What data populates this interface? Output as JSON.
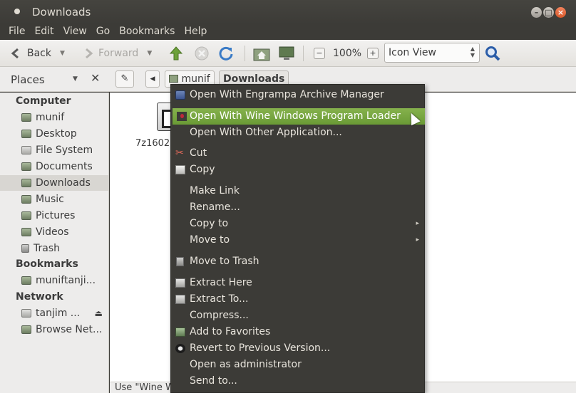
{
  "window": {
    "title": "Downloads"
  },
  "menubar": [
    "File",
    "Edit",
    "View",
    "Go",
    "Bookmarks",
    "Help"
  ],
  "toolbar": {
    "back_label": "Back",
    "forward_label": "Forward",
    "zoom_level": "100%",
    "view_mode": "Icon View"
  },
  "pathbar": {
    "places_label": "Places",
    "crumbs": [
      "munif",
      "Downloads"
    ]
  },
  "sidebar": {
    "computer_header": "Computer",
    "computer_items": [
      "munif",
      "Desktop",
      "File System",
      "Documents",
      "Downloads",
      "Music",
      "Pictures",
      "Videos",
      "Trash"
    ],
    "bookmarks_header": "Bookmarks",
    "bookmarks_items": [
      "muniftanji..."
    ],
    "network_header": "Network",
    "network_items": [
      "tanjim ...",
      "Browse Net..."
    ]
  },
  "content": {
    "file_label": "7z1602",
    "status_text": "Use \"Wine W"
  },
  "context_menu": {
    "items": [
      "Open With Engrampa Archive Manager",
      "Open With Wine Windows Program Loader",
      "Open With Other Application...",
      "Cut",
      "Copy",
      "Make Link",
      "Rename...",
      "Copy to",
      "Move to",
      "Move to Trash",
      "Extract Here",
      "Extract To...",
      "Compress...",
      "Add to Favorites",
      "Revert to Previous Version...",
      "Open as administrator",
      "Send to..."
    ],
    "highlighted_index": 1
  },
  "colors": {
    "titlebar": "#3c3b37",
    "menu_bg": "#3c3b37",
    "highlight": "#7aa843",
    "sidebar_bg": "#edeceb"
  }
}
